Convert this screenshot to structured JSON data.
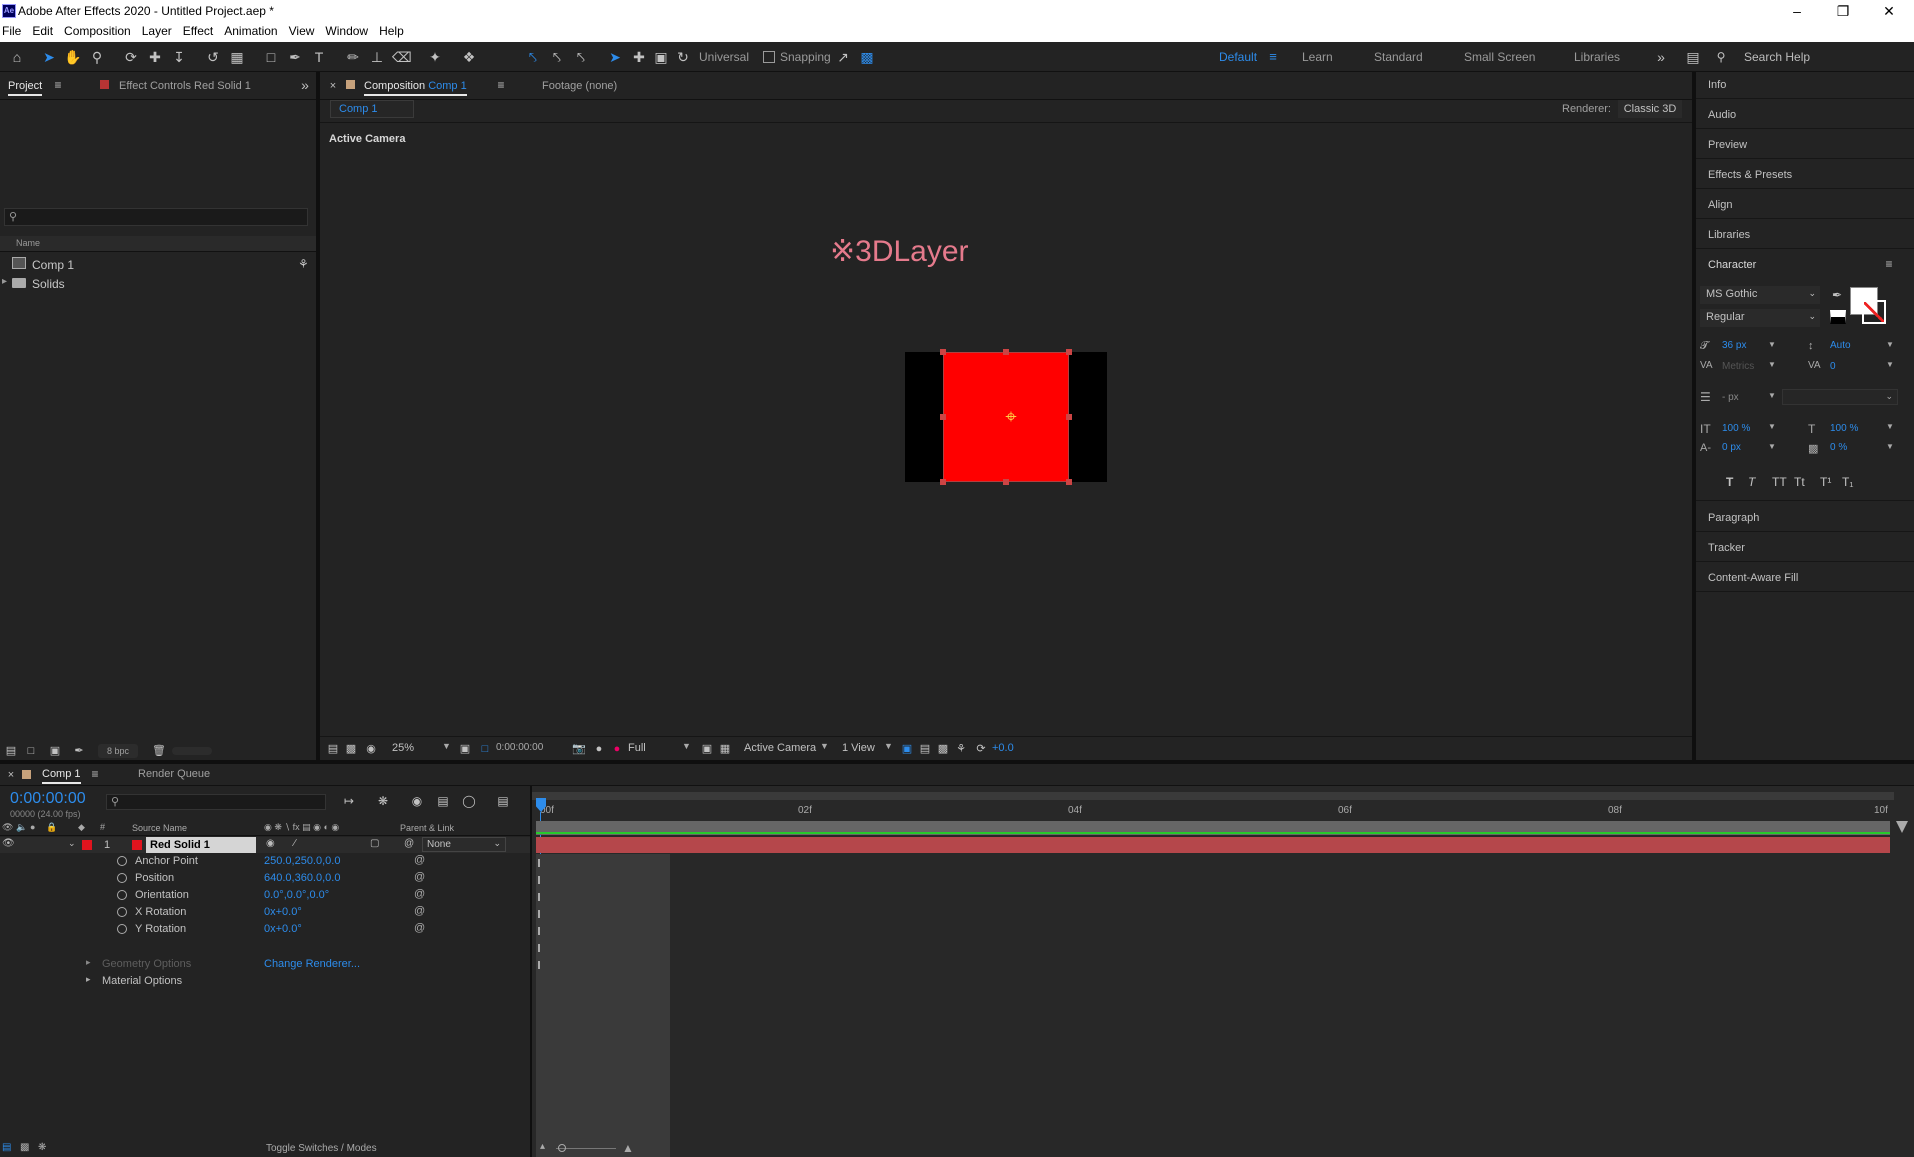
{
  "window": {
    "title": "Adobe After Effects 2020 - Untitled Project.aep *",
    "app_icon": "Ae",
    "controls": [
      "minimize-icon",
      "maximize-icon",
      "close-icon"
    ]
  },
  "menu": [
    "File",
    "Edit",
    "Composition",
    "Layer",
    "Effect",
    "Animation",
    "View",
    "Window",
    "Help"
  ],
  "toolbar": {
    "universal_label": "Universal",
    "snapping_label": "Snapping",
    "workspaces": [
      "Default",
      "Learn",
      "Standard",
      "Small Screen",
      "Libraries"
    ],
    "active_workspace": "Default",
    "search_placeholder": "Search Help"
  },
  "project_panel": {
    "tab_project": "Project",
    "tab_effect_controls_prefix": "Effect Controls",
    "tab_effect_controls_layer": "Red Solid 1",
    "column_name": "Name",
    "items": [
      {
        "name": "Comp 1",
        "type": "composition"
      },
      {
        "name": "Solids",
        "type": "folder"
      }
    ],
    "bpc_label": "8 bpc"
  },
  "composition_panel": {
    "tab_prefix": "Composition",
    "tab_comp": "Comp 1",
    "tab_footage": "Footage (none)",
    "subtab": "Comp 1",
    "renderer_label": "Renderer:",
    "renderer_value": "Classic 3D",
    "active_camera_label": "Active Camera",
    "overlay_text": "※3DLayer",
    "zoom": "25%",
    "timecode": "0:00:00:00",
    "resolution": "Full",
    "camera_view": "Active Camera",
    "views": "1 View",
    "exposure": "+0.0"
  },
  "right_panel": {
    "items_top": [
      "Info",
      "Audio",
      "Preview",
      "Effects & Presets",
      "Align",
      "Libraries"
    ],
    "character": {
      "title": "Character",
      "font": "MS Gothic",
      "style": "Regular",
      "size": "36 px",
      "leading": "Auto",
      "kerning": "Metrics",
      "tracking": "0",
      "stroke_width": "- px",
      "vscale": "100 %",
      "hscale": "100 %",
      "baseline": "0 px",
      "tsume": "0 %",
      "style_buttons": [
        "T",
        "T",
        "TT",
        "Tt",
        "T¹",
        "T₁"
      ]
    },
    "items_bottom": [
      "Paragraph",
      "Tracker",
      "Content-Aware Fill"
    ]
  },
  "timeline": {
    "tab_comp": "Comp 1",
    "tab_render_queue": "Render Queue",
    "timecode": "0:00:00:00",
    "fps_label": "00000 (24.00 fps)",
    "col_source_name": "Source Name",
    "col_parent": "Parent & Link",
    "ruler_labels": [
      "00f",
      "02f",
      "04f",
      "06f",
      "08f",
      "10f"
    ],
    "layer": {
      "index": "1",
      "name": "Red Solid 1",
      "parent": "None",
      "color": "#e0141e"
    },
    "properties": [
      {
        "name": "Anchor Point",
        "value": "250.0,250.0,0.0"
      },
      {
        "name": "Position",
        "value": "640.0,360.0,0.0"
      },
      {
        "name": "Orientation",
        "value": "0.0°,0.0°,0.0°"
      },
      {
        "name": "X Rotation",
        "value": "0x+0.0°"
      },
      {
        "name": "Y Rotation",
        "value": "0x+0.0°"
      }
    ],
    "geometry_options": "Geometry Options",
    "change_renderer": "Change Renderer...",
    "material_options": "Material Options",
    "toggle_label": "Toggle Switches / Modes"
  },
  "colors": {
    "accent": "#2d8ceb",
    "solid_red": "#ff0000",
    "layer_bar": "#b5474b",
    "overlay_text": "#e57a8c"
  }
}
